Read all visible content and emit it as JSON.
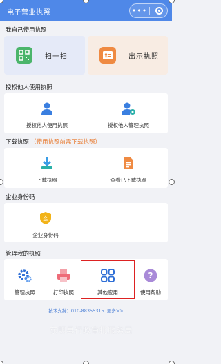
{
  "titlebar": {
    "title": "电子营业执照"
  },
  "sections": {
    "self_use": "我自己使用执照",
    "authorize": "授权他人使用执照",
    "download": "下载执照",
    "download_note": "（使用执照前需下载执照）",
    "identity": "企业身份码",
    "manage": "管理我的执照"
  },
  "self_use": {
    "scan_label": "扫一扫",
    "show_label": "出示执照"
  },
  "authorize": {
    "use_label": "授权他人使用执照",
    "manage_label": "授权他人管理执照"
  },
  "download": {
    "download_label": "下载执照",
    "view_label": "查看已下载执照"
  },
  "identity": {
    "label": "企业身份码"
  },
  "manage": {
    "items": [
      "管理执照",
      "打印执照",
      "其他应用",
      "使用帮助"
    ]
  },
  "footer": {
    "support": "技术支持：010-88355315",
    "more": "更多>>"
  },
  "watermark": "东明县行政审批服务局",
  "colors": {
    "brand": "#4f88e8",
    "warn": "#e8772a",
    "highlight": "#dd2222"
  }
}
